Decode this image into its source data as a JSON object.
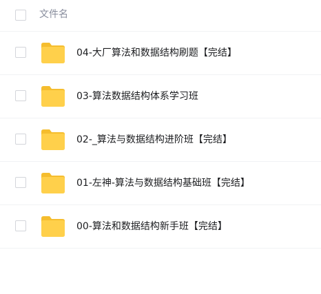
{
  "header": {
    "column_label": "文件名"
  },
  "files": [
    {
      "name": "04-大厂算法和数据结构刷题【完结】",
      "type": "folder"
    },
    {
      "name": "03-算法数据结构体系学习班",
      "type": "folder"
    },
    {
      "name": "02-_算法与数据结构进阶班【完结】",
      "type": "folder"
    },
    {
      "name": "01-左神-算法与数据结构基础班【完结】",
      "type": "folder"
    },
    {
      "name": "00-算法和数据结构新手班【完结】",
      "type": "folder"
    }
  ],
  "colors": {
    "folder": "#ffd04b",
    "folder_tab": "#f5bd2e",
    "text": "#1b1c1f",
    "header_text": "#878c9c",
    "divider": "#f1f2f4",
    "checkbox_border": "#d3d5da"
  },
  "icons": {
    "row_icon": "folder-icon",
    "select": "checkbox-icon"
  }
}
